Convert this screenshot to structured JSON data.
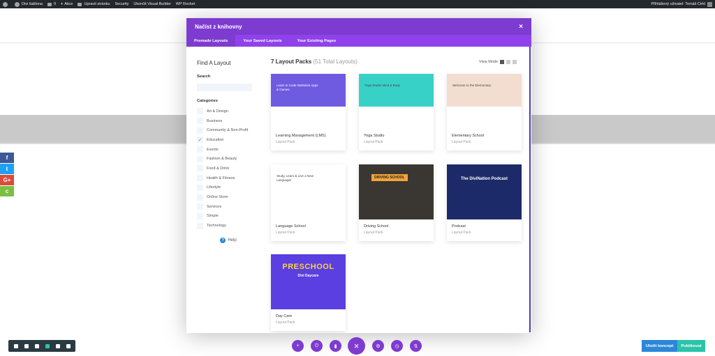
{
  "adminbar": {
    "items": [
      "Divi šablona",
      "0",
      "Akce",
      "Upravit stránku",
      "Security",
      "Ukončit Visual Builder",
      "WP Rocket"
    ],
    "user": "Přihlášený uživatel: Tomáš Cirkl"
  },
  "social": [
    {
      "icon": "f",
      "color": "#3b5998"
    },
    {
      "icon": "t",
      "color": "#1da1f2"
    },
    {
      "icon": "G+",
      "color": "#dd4b39"
    },
    {
      "icon": "c",
      "color": "#7ac143"
    }
  ],
  "modal": {
    "title": "Načíst z knihovny",
    "close": "×",
    "tabs": [
      "Premade Layouts",
      "Your Saved Layouts",
      "Your Existing Pages"
    ],
    "sidebar": {
      "heading": "Find A Layout",
      "search_label": "Search",
      "search_placeholder": "",
      "categories_label": "Categories",
      "categories": [
        {
          "label": "Art & Design",
          "checked": false
        },
        {
          "label": "Business",
          "checked": false
        },
        {
          "label": "Community & Non-Profit",
          "checked": false
        },
        {
          "label": "Education",
          "checked": true
        },
        {
          "label": "Events",
          "checked": false
        },
        {
          "label": "Fashion & Beauty",
          "checked": false
        },
        {
          "label": "Food & Drink",
          "checked": false
        },
        {
          "label": "Health & Fitness",
          "checked": false
        },
        {
          "label": "Lifestyle",
          "checked": false
        },
        {
          "label": "Online Store",
          "checked": false
        },
        {
          "label": "Services",
          "checked": false
        },
        {
          "label": "Simple",
          "checked": false
        },
        {
          "label": "Technology",
          "checked": false
        }
      ],
      "help": "Help"
    },
    "main": {
      "title": "7 Layout Packs",
      "subtitle": "(51 Total Layouts)",
      "view_mode": "View Mode",
      "cards": [
        {
          "name": "Learning Management (LMS)",
          "meta": "Layout Pack",
          "thumb_text": "Learn to Code Websites Apps & Games",
          "bg": "#6f5be0"
        },
        {
          "name": "Yoga Studio",
          "meta": "Layout Pack",
          "thumb_text": "Yoga Studio Mind & Body",
          "bg": "#38d1c8"
        },
        {
          "name": "Elementary School",
          "meta": "Layout Pack",
          "thumb_text": "Welcome to the Elementary",
          "bg": "#f3ddd1"
        },
        {
          "name": "Language School",
          "meta": "Layout Pack",
          "thumb_text": "Study, Learn & Live a New Language!",
          "bg": "#ffffff"
        },
        {
          "name": "Driving School",
          "meta": "Layout Pack",
          "thumb_text": "DRIVING SCHOOL",
          "bg": "#3a3632"
        },
        {
          "name": "Podcast",
          "meta": "Layout Pack",
          "thumb_text": "The DiviNation Podcast",
          "bg": "#1d2a6a"
        },
        {
          "name": "Day Care",
          "meta": "Layout Pack",
          "thumb_text": "PRESCHOOL",
          "thumb_sub": "Divi Daycare",
          "bg": "#5b3fe0"
        }
      ]
    }
  },
  "bottom": {
    "save_draft": "Uložit koncept",
    "publish": "Publikovat",
    "close_icon": "×"
  }
}
